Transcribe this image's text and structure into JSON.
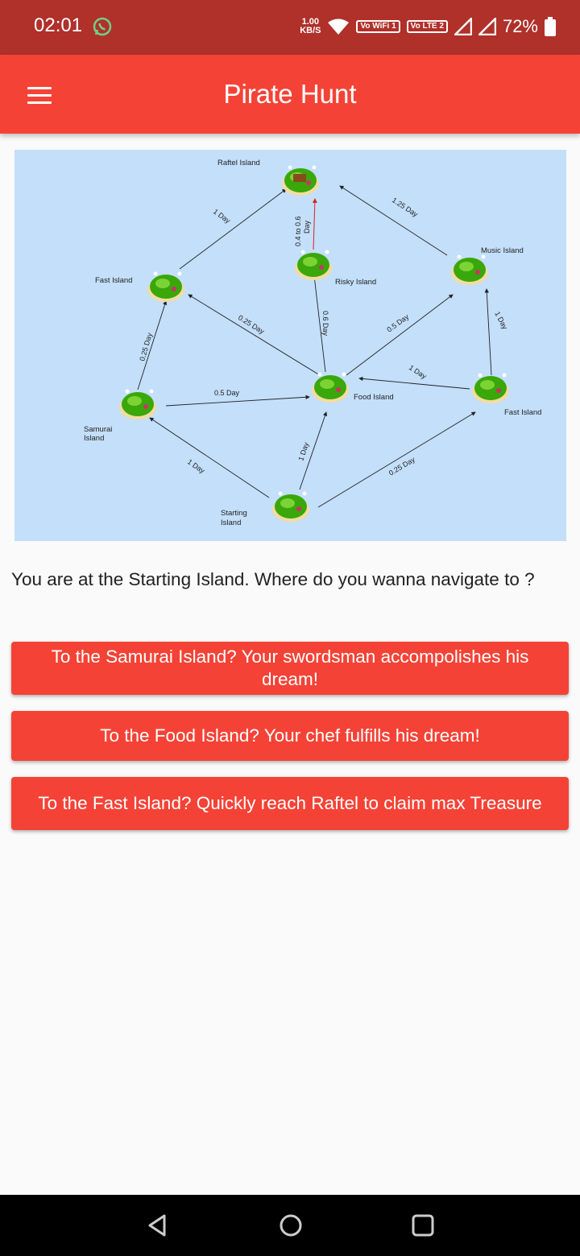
{
  "status_bar": {
    "time": "02:01",
    "speed_value": "1.00",
    "speed_unit": "KB/S",
    "vowifi": "Vo WiFi 1",
    "volte": "Vo LTE 2",
    "battery": "72%",
    "icons": [
      "whatsapp-icon",
      "wifi-icon",
      "signal-icon",
      "signal-roaming-icon",
      "battery-icon"
    ]
  },
  "app_bar": {
    "title": "Pirate Hunt",
    "menu_icon": "hamburger-menu-icon"
  },
  "map": {
    "labels": {
      "raftel": "Raftel Island",
      "music": "Music Island",
      "fast_left": "Fast Island",
      "risky": "Risky Island",
      "food": "Food Island",
      "fast_right": "Fast Island",
      "samurai_1": "Samurai",
      "samurai_2": "Island",
      "starting_1": "Starting",
      "starting_2": "Island"
    },
    "edges": {
      "fast_raftel": "1 Day",
      "music_raftel": "1.25 Day",
      "risky_raftel_1": "0.4 to 0.6",
      "risky_raftel_2": "Day",
      "food_fastleft": "0.25 Day",
      "food_risky": "0.6 Day",
      "food_music": "0.5 Day",
      "music_fastright": "1 Day",
      "fastright_food": "1 Day",
      "samurai_fastleft": "0.25 Day",
      "samurai_food": "0.5 Day",
      "start_samurai": "1 Day",
      "start_food": "1 Day",
      "start_fastright": "0.25 Day"
    }
  },
  "prompt": "You are at the Starting Island. Where do you wanna navigate to ?",
  "options": [
    "To the Samurai Island? Your swordsman accompolishes his dream!",
    "To the Food Island? Your chef fulfills his dream!",
    "To the Fast Island? Quickly reach Raftel to claim max Treasure"
  ],
  "colors": {
    "status_bar": "#b0302a",
    "app_bar": "#f44336",
    "button": "#f44336",
    "map_bg": "#c3dffa",
    "island_green": "#3aa70a"
  },
  "nav_bar": {
    "icons": [
      "back-icon",
      "home-icon",
      "recents-icon"
    ]
  }
}
